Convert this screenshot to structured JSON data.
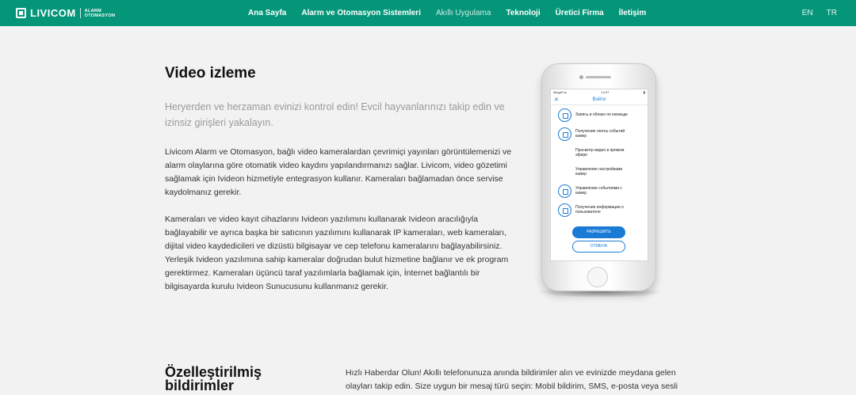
{
  "nav": {
    "brand": "LIVICOM",
    "brand_sub_1": "ALARM",
    "brand_sub_2": "OTOMASYON",
    "items": [
      "Ana Sayfa",
      "Alarm ve Otomasyon Sistemleri",
      "Akıllı Uygulama",
      "Teknoloji",
      "Üretici Firma",
      "İletişim"
    ],
    "active_index": 2,
    "lang": [
      "EN",
      "TR"
    ],
    "color": "#05967a"
  },
  "section": {
    "title": "Video izleme",
    "lead": "Heryerden ve herzaman evinizi kontrol edin! Evcil hayvanlarınızı takip edin ve izinsiz girişleri yakalayın.",
    "p1": "Livicom Alarm ve Otomasyon, bağlı video kameralardan çevrimiçi yayınları görüntülemenizi ve alarm olaylarına göre otomatik video kaydını yapılandırmanızı sağlar. Livicom, video gözetimi sağlamak için Ivideon hizmetiyle entegrasyon kullanır. Kameraları bağlamadan önce servise kaydolmanız gerekir.",
    "p2": "Kameraları ve video kayıt cihazlarını Ivideon yazılımını kullanarak Ivideon aracılığıyla bağlayabilir ve ayrıca başka bir satıcının yazılımını kullanarak IP kameraları, web kameraları, dijital video kaydedicileri ve dizüstü bilgisayar ve cep telefonu kameralarını bağlayabilirsiniz. Yerleşik Ivideon yazılımına sahip kameralar doğrudan bulut hizmetine bağlanır ve ek program gerektirmez. Kameraları üçüncü taraf yazılımlarla bağlamak için, İnternet bağlantılı bir bilgisayarda kurulu Ivideon Sunucusunu kullanmanız gerekir."
  },
  "phone": {
    "carrier": "MegaFon",
    "time": "14:37",
    "header": "Войти",
    "close": "✕",
    "rows": [
      {
        "icon": "cloud-icon",
        "text": "Запись в облако по команде"
      },
      {
        "icon": "list-icon",
        "text": "Получение ленты событий камер"
      },
      {
        "icon": "",
        "text": "Просмотр видео в прямом эфире"
      },
      {
        "icon": "",
        "text": "Управление настройками камер"
      },
      {
        "icon": "list-icon",
        "text": "Управление событиями с камер"
      },
      {
        "icon": "user-icon",
        "text": "Получение информации о пользователе"
      }
    ],
    "allow": "РАЗРЕШИТЬ",
    "cancel": "ОТМЕНА"
  },
  "next": {
    "title": "Özelleştirilmiş bildirimler",
    "text": "Hızlı Haberdar Olun! Akıllı telefonunuza anında bildirimler alın ve evinizde meydana gelen olayları takip edin. Size uygun bir mesaj türü seçin: Mobil bildirim, SMS, e-posta veya sesli"
  }
}
